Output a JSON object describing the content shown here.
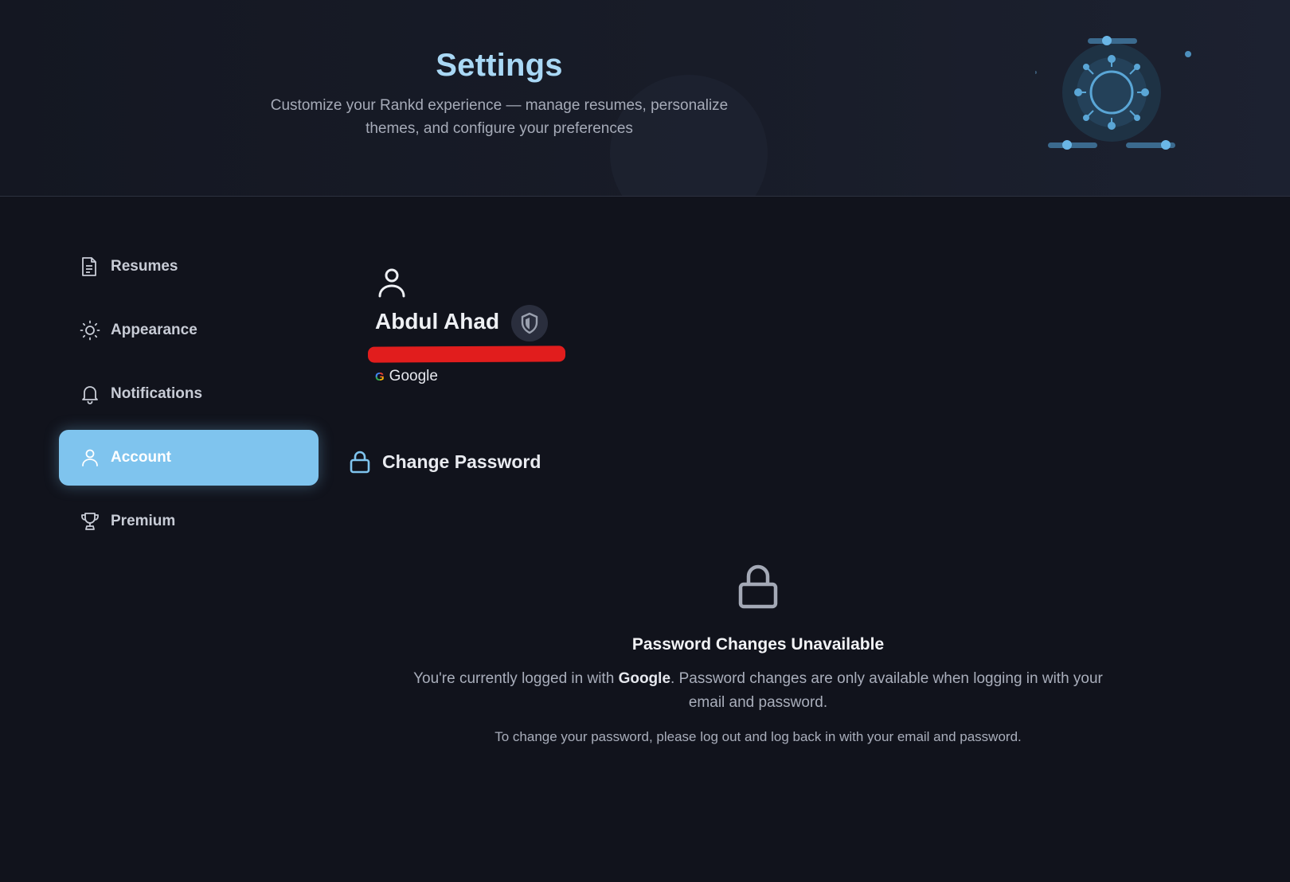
{
  "header": {
    "title": "Settings",
    "subtitle": "Customize your Rankd experience — manage resumes, personalize themes, and configure your preferences"
  },
  "sidebar": {
    "items": [
      {
        "label": "Resumes",
        "icon": "document-icon",
        "active": false
      },
      {
        "label": "Appearance",
        "icon": "sun-icon",
        "active": false
      },
      {
        "label": "Notifications",
        "icon": "bell-icon",
        "active": false
      },
      {
        "label": "Account",
        "icon": "user-icon",
        "active": true
      },
      {
        "label": "Premium",
        "icon": "trophy-icon",
        "active": false
      }
    ]
  },
  "account": {
    "name": "Abdul Ahad",
    "provider": "Google",
    "provider_logo": "G"
  },
  "change_password": {
    "label": "Change Password",
    "unavailable_title": "Password Changes Unavailable",
    "text_prefix": "You're currently logged in with ",
    "text_provider": "Google",
    "text_suffix": ". Password changes are only available when logging in with your email and password.",
    "note": "To change your password, please log out and log back in with your email and password."
  },
  "colors": {
    "accent": "#7fc4ee",
    "title": "#a9d8f5",
    "background": "#11131c",
    "redaction": "#e11d1d"
  }
}
